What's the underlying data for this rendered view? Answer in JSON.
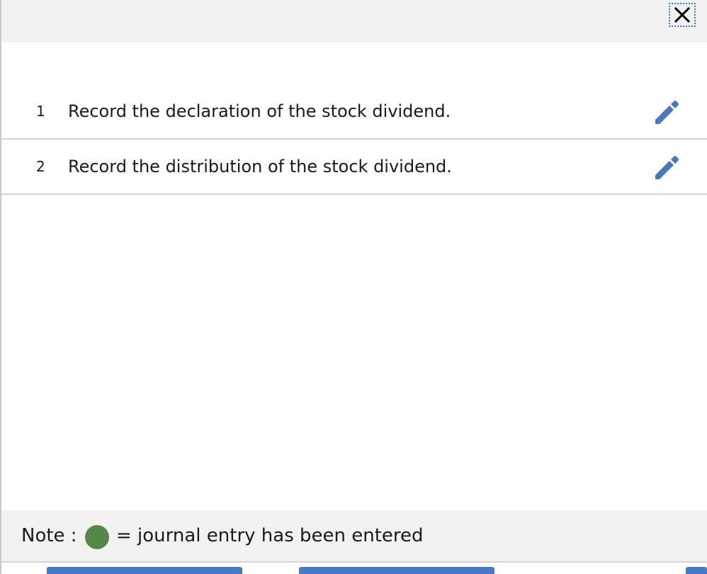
{
  "title_bar": {
    "close_icon": "close-icon"
  },
  "tasks": [
    {
      "number": "1",
      "label": "Record the declaration of the stock dividend.",
      "icon": "pencil-edit-icon"
    },
    {
      "number": "2",
      "label": "Record the distribution of the stock dividend.",
      "icon": "pencil-edit-icon"
    }
  ],
  "note": {
    "label": "Note :",
    "indicator_color": "#55864a",
    "text": "= journal entry has been entered"
  },
  "colors": {
    "accent": "#4a78c0",
    "edit_icon": "#4a78c0",
    "panel_background": "#f2f2f2"
  }
}
